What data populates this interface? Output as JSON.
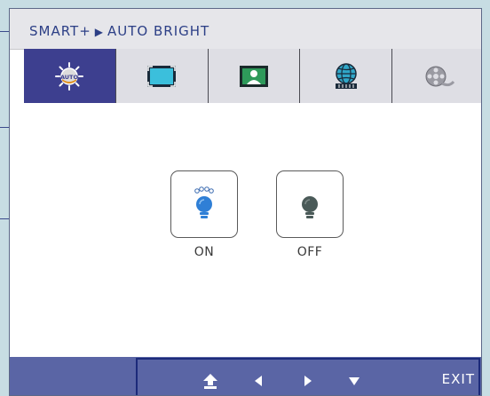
{
  "breadcrumb": {
    "section": "SMART+",
    "separator_icon": "triangle-right-icon",
    "current": "AUTO BRIGHT"
  },
  "tabs": [
    {
      "icon": "auto-bright-icon",
      "active": true
    },
    {
      "icon": "screen-size-icon",
      "active": false
    },
    {
      "icon": "picture-mode-icon",
      "active": false
    },
    {
      "icon": "globe-icon",
      "active": false
    },
    {
      "icon": "film-reel-icon",
      "active": false
    }
  ],
  "options": [
    {
      "label": "ON",
      "icon": "bulb-on-icon",
      "selected": true
    },
    {
      "label": "OFF",
      "icon": "bulb-off-icon",
      "selected": false
    }
  ],
  "footer": {
    "icons": [
      "enter-icon",
      "arrow-left-icon",
      "arrow-right-icon",
      "arrow-down-icon"
    ],
    "exit_label": "EXIT"
  },
  "colors": {
    "accent": "#3d3f8f",
    "footer": "#5a65a5",
    "title_text": "#2c3f86",
    "bulb_on": "#2f7fd6",
    "bulb_off": "#4a5a58"
  }
}
